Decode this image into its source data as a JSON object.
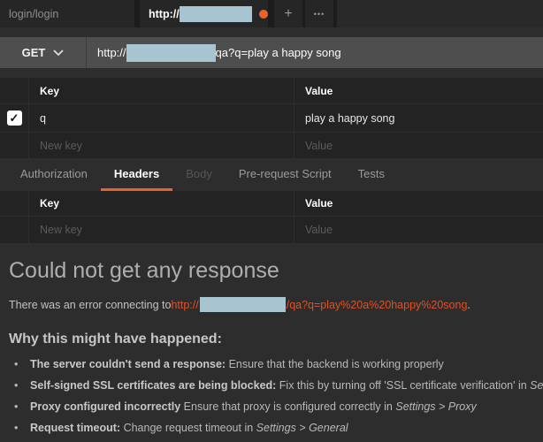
{
  "colors": {
    "accent_orange": "#ea622c",
    "link_orange": "#de5126",
    "redact_blue": "#a9c4d1"
  },
  "topbar": {
    "doc_tab_label": "login/login",
    "request_tab_url_prefix": "http://",
    "new_tab_label": "+",
    "more_label": "•••"
  },
  "request": {
    "method": "GET",
    "url_prefix": "http://",
    "url_suffix": "qa?q=play a happy song"
  },
  "params_table": {
    "key_header": "Key",
    "value_header": "Value",
    "rows": [
      {
        "key": "q",
        "value": "play a happy song",
        "checked": "✓"
      }
    ],
    "new_key_placeholder": "New key",
    "new_value_placeholder": "Value"
  },
  "request_tabs": [
    {
      "label": "Authorization"
    },
    {
      "label": "Headers"
    },
    {
      "label": "Body"
    },
    {
      "label": "Pre-request Script"
    },
    {
      "label": "Tests"
    }
  ],
  "headers_table": {
    "key_header": "Key",
    "value_header": "Value",
    "new_key_placeholder": "New key",
    "new_value_placeholder": "Value"
  },
  "error": {
    "title": "Could not get any response",
    "message_prefix": "There was an error connecting to ",
    "link_prefix": "http://",
    "link_suffix": "/qa?q=play%20a%20happy%20song",
    "message_end": ".",
    "why_title": "Why this might have happened:",
    "reasons": [
      {
        "bold": "The server couldn't send a response:",
        "text": " Ensure that the backend is working properly",
        "italic": ""
      },
      {
        "bold": "Self-signed SSL certificates are being blocked:",
        "text": " Fix this by turning off 'SSL certificate verification' in ",
        "italic": "Settings"
      },
      {
        "bold": "Proxy configured incorrectly",
        "text": " Ensure that proxy is configured correctly in ",
        "italic": "Settings > Proxy"
      },
      {
        "bold": "Request timeout:",
        "text": " Change request timeout in ",
        "italic": "Settings > General"
      }
    ]
  }
}
